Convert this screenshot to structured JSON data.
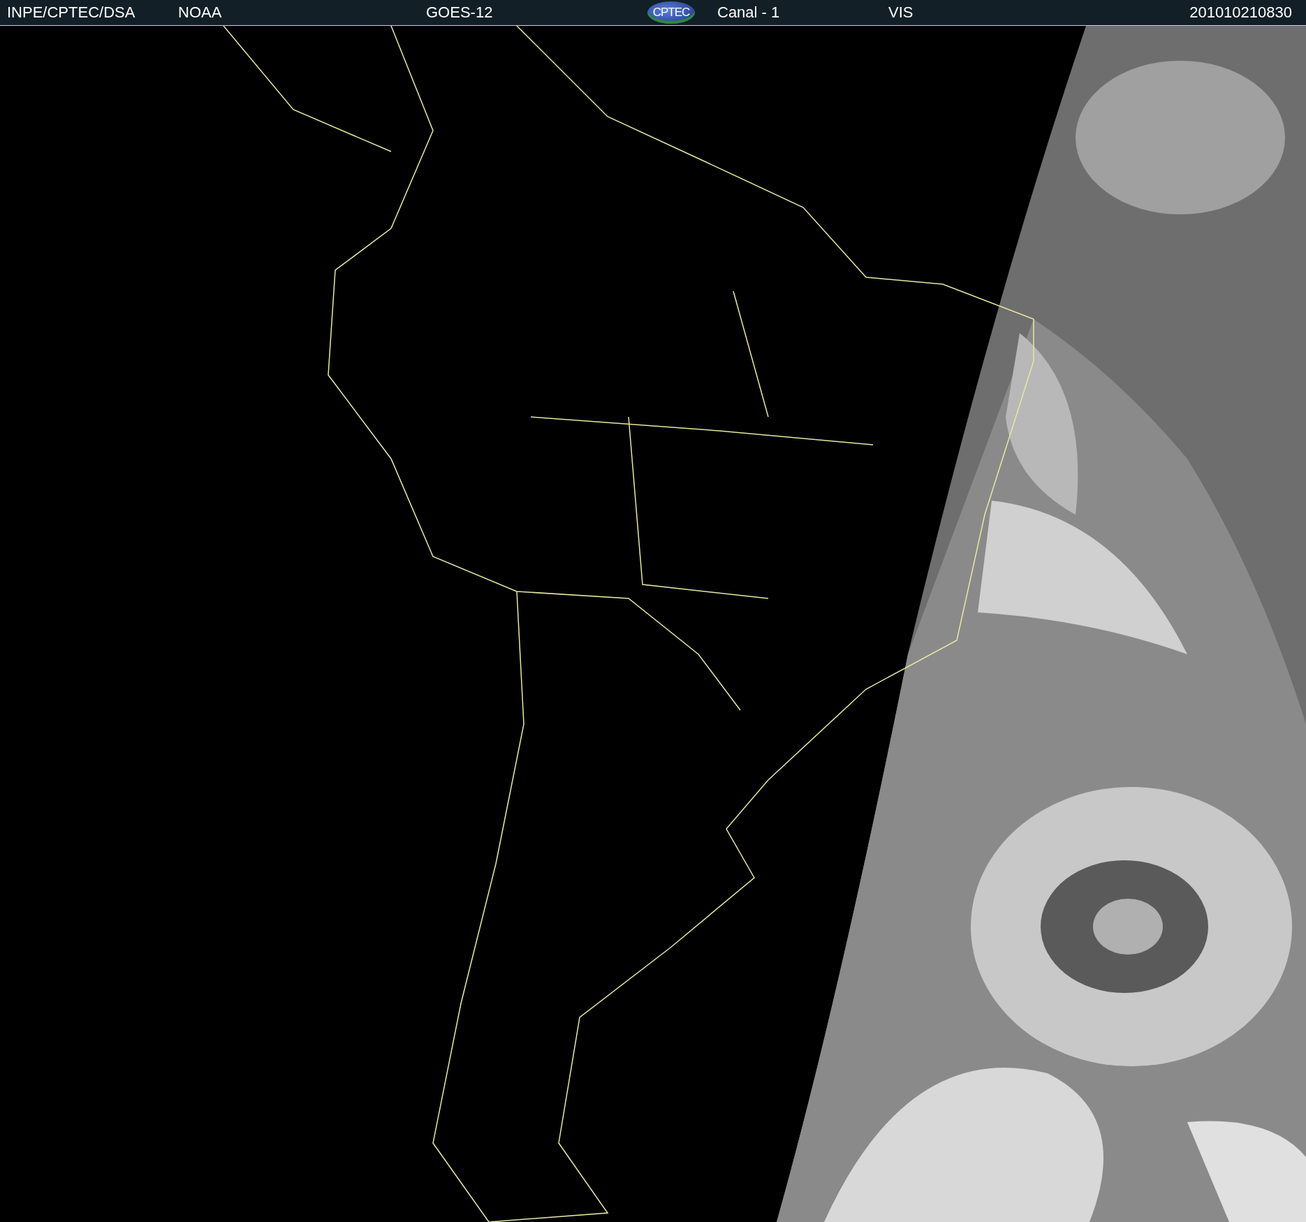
{
  "header": {
    "items": [
      {
        "kind": "text",
        "text": "INPE/CPTEC/DSA"
      },
      {
        "kind": "text",
        "text": "NOAA"
      },
      {
        "kind": "text",
        "text": "GOES-12"
      },
      {
        "kind": "logo",
        "text": "CPTEC"
      },
      {
        "kind": "text",
        "text": "Canal - 1"
      },
      {
        "kind": "text",
        "text": "VIS"
      },
      {
        "kind": "text",
        "text": "201010210830"
      }
    ]
  }
}
